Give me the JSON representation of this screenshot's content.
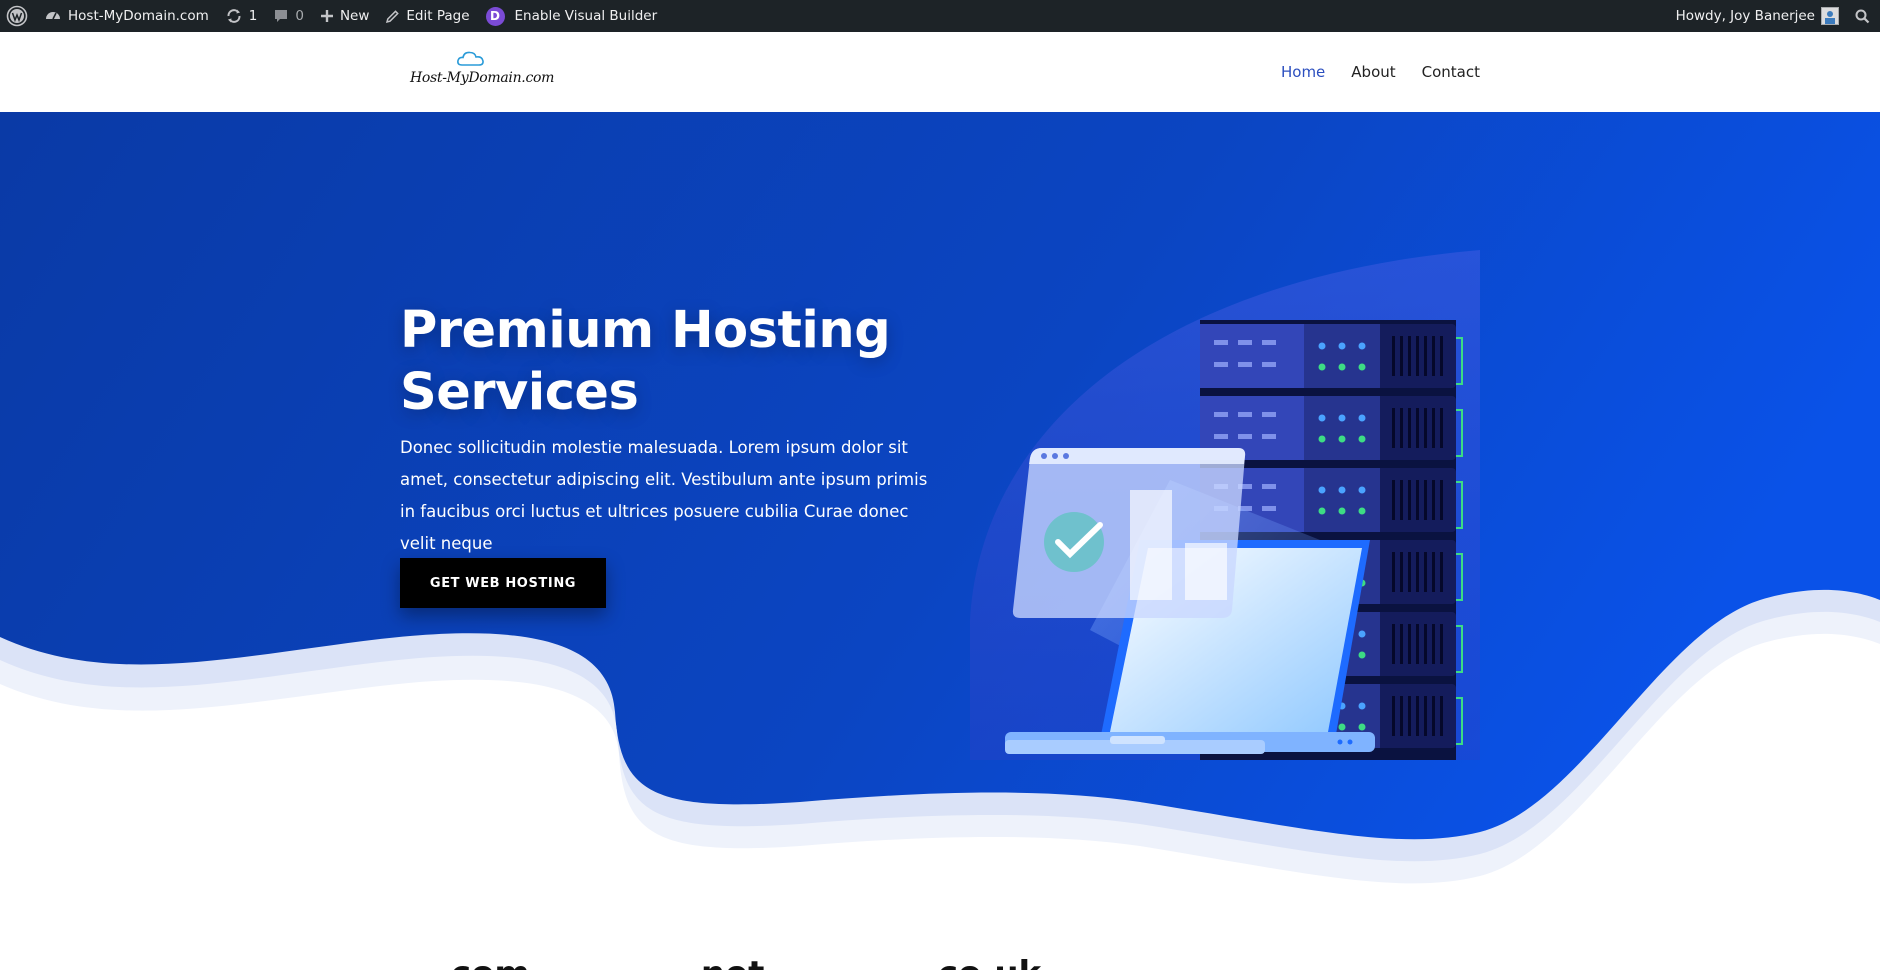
{
  "adminbar": {
    "site_name": "Host-MyDomain.com",
    "updates_count": "1",
    "comments_count": "0",
    "new_label": "New",
    "edit_label": "Edit Page",
    "builder_label": "Enable Visual Builder",
    "builder_icon_letter": "D",
    "greeting": "Howdy, Joy Banerjee",
    "icons": [
      "wordpress-icon",
      "dashboard-icon",
      "updates-icon",
      "comment-icon",
      "plus-icon",
      "pencil-icon",
      "divi-icon",
      "avatar",
      "search-icon"
    ]
  },
  "header": {
    "logo_text": "Host-MyDomain.com",
    "nav": [
      {
        "label": "Home",
        "active": true
      },
      {
        "label": "About",
        "active": false
      },
      {
        "label": "Contact",
        "active": false
      }
    ]
  },
  "hero": {
    "title_line1": "Premium Hosting",
    "title_line2": "Services",
    "description": "Donec sollicitudin molestie malesuada. Lorem ipsum dolor sit amet, consectetur adipiscing elit. Vestibulum ante ipsum primis in faucibus orci luctus et ultrices posuere cubilia Curae donec velit neque",
    "button_label": "GET WEB HOSTING"
  },
  "tlds": [
    ".com",
    ".net",
    ".co.uk"
  ],
  "colors": {
    "adminbar": "#1d2327",
    "hero_blue": "#0b47c9",
    "hero_blue_dark": "#0a3fa8",
    "accent_nav": "#2c4fbf",
    "server_dark": "#151a4a",
    "led_blue": "#4aa3ff",
    "led_green": "#3ddc84"
  }
}
